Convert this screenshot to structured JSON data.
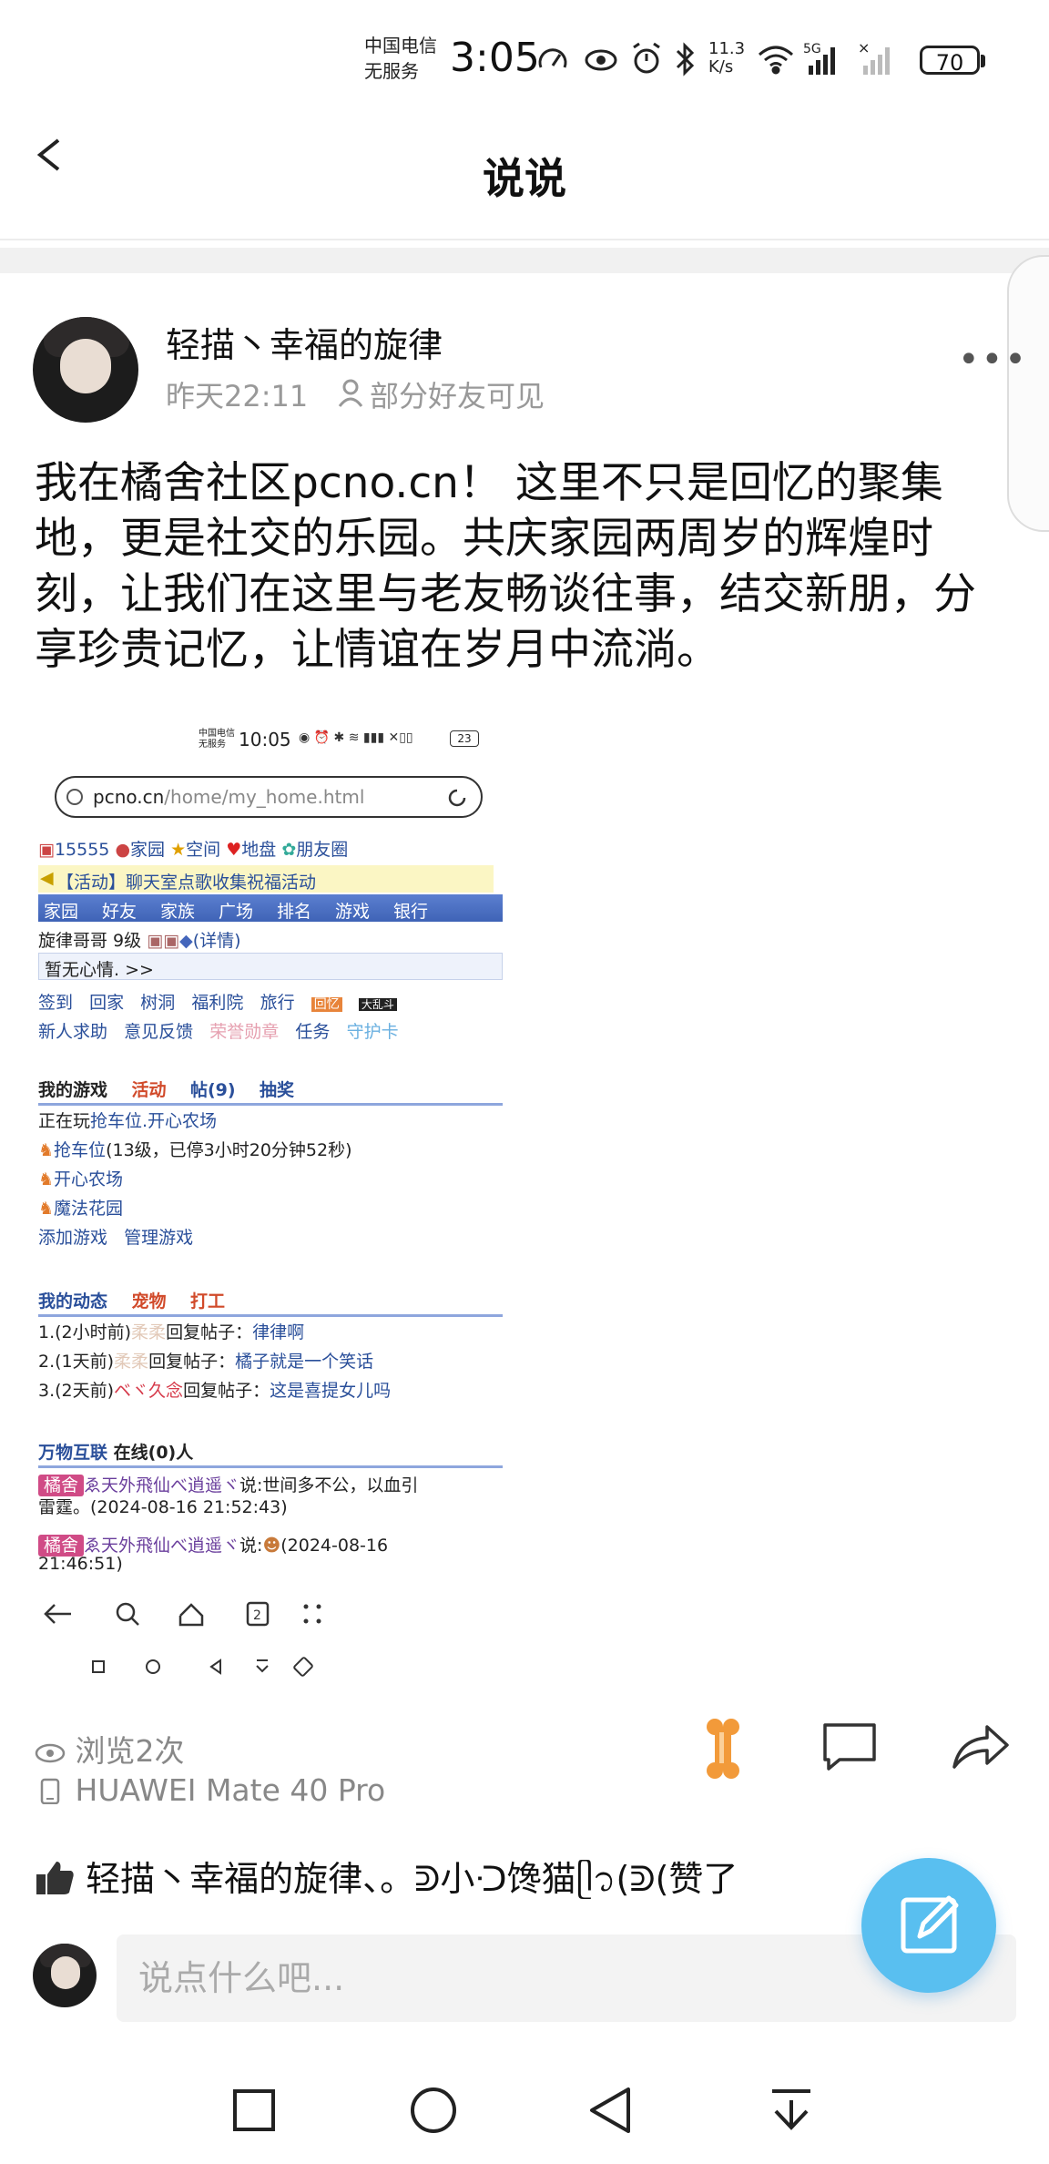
{
  "status": {
    "carrier_line1": "中国电信",
    "carrier_line2": "无服务",
    "time": "3:05",
    "net_speed_value": "11.3",
    "net_speed_unit": "K/s",
    "battery": "70",
    "icons": [
      "speed-gauge-icon",
      "eye-icon",
      "alarm-icon",
      "bluetooth-icon",
      "wifi-icon",
      "5g-signal-icon",
      "no-signal-icon",
      "battery-icon"
    ]
  },
  "header": {
    "title": "说说"
  },
  "post": {
    "username": "轻描丶幸福的旋律",
    "time": "昨天22:11",
    "visibility": "部分好友可见",
    "content": "我在橘舍社区pcno.cn！ 这里不只是回忆的聚集地，更是社交的乐园。共庆家园两周岁的辉煌时刻，让我们在这里与老友畅谈往事，结交新朋，分享珍贵记忆，让情谊在岁月中流淌。",
    "views": "浏览2次",
    "device": "HUAWEI Mate 40 Pro",
    "likes": "轻描丶幸福的旋律、。ᕲ小ᑝ馋猫ᥫ᭡(ᕲ(赞了"
  },
  "shot": {
    "carrier_line1": "中国电信",
    "carrier_line2": "无服务",
    "time": "10:05",
    "battery": "23",
    "url_host": "pcno.cn",
    "url_path": "/home/my_home.html",
    "top_links": [
      "15555",
      "家园",
      "空间",
      "地盘",
      "朋友圈"
    ],
    "notice": "【活动】聊天室点歌收集祝福活动",
    "nav": [
      "家园",
      "好友",
      "家族",
      "广场",
      "排名",
      "游戏",
      "银行"
    ],
    "user_line": "旋律哥哥  9级",
    "user_detail": "(详情)",
    "mood": "暂无心情. >>",
    "links1": [
      "签到",
      "回家",
      "树洞",
      "福利院",
      "旅行"
    ],
    "badge1": "回忆",
    "badge2": "大乱斗",
    "links2": [
      "新人求助",
      "意见反馈",
      "荣誉勋章",
      "任务",
      "守护卡"
    ],
    "games_header": "我的游戏",
    "games_tabs": [
      "活动",
      "帖(9)",
      "抽奖"
    ],
    "playing_prefix": "正在玩",
    "playing_games": "抢车位.开心农场",
    "game1_name": "抢车位",
    "game1_detail": "(13级，已停3小时20分钟52秒)",
    "game2": "开心农场",
    "game3": "魔法花园",
    "game_links": [
      "添加游戏",
      "管理游戏"
    ],
    "dyn_header": "我的动态",
    "dyn_tabs": [
      "宠物",
      "打工"
    ],
    "dyn": [
      {
        "prefix": "1.(2小时前)",
        "name": "柔柔",
        "mid": "回复帖子：",
        "link": "律律啊"
      },
      {
        "prefix": "2.(1天前)",
        "name": "柔柔",
        "mid": "回复帖子：",
        "link": "橘子就是一个笑话"
      },
      {
        "prefix": "3.(2天前)",
        "name": "ベヾ久念",
        "mid": "回复帖子：",
        "link": "这是喜提女儿吗"
      }
    ],
    "iot_header": "万物互联",
    "iot_online": "在线(0)人",
    "msg1_tag": "橘舍",
    "msg1_user": "ゑ天外飛仙べ逍遥ヾ",
    "msg1_text": "说:世间多不公，以血引",
    "msg1_text2": "雷霆。(2024-08-16 21:52:43)",
    "msg2_tag": "橘舍",
    "msg2_user": "ゑ天外飛仙べ逍遥ヾ",
    "msg2_text": "说:",
    "msg2_time": "(2024-08-16",
    "msg2_time2": "21:46:51)",
    "bottom_tab_count": "2"
  },
  "comment": {
    "placeholder": "说点什么吧..."
  },
  "colors": {
    "fab": "#59bff0",
    "link_blue": "#2a4f9a",
    "accent_red": "#d14a2a",
    "bone": "#f29a3a"
  }
}
